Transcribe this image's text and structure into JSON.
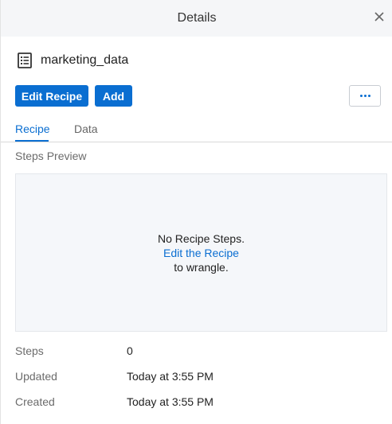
{
  "header": {
    "title": "Details"
  },
  "recipe": {
    "name": "marketing_data"
  },
  "actions": {
    "edit_label": "Edit Recipe",
    "add_label": "Add"
  },
  "tabs": [
    {
      "label": "Recipe"
    },
    {
      "label": "Data"
    }
  ],
  "preview": {
    "section_label": "Steps Preview",
    "empty_line1": "No Recipe Steps.",
    "link_text": "Edit the Recipe",
    "empty_line3": "to wrangle."
  },
  "meta": [
    {
      "label": "Steps",
      "value": "0"
    },
    {
      "label": "Updated",
      "value": "Today at 3:55 PM"
    },
    {
      "label": "Created",
      "value": "Today at 3:55 PM"
    }
  ],
  "icons": {
    "close": "close-icon",
    "recipe": "recipe-document-icon",
    "more": "more-horizontal-icon"
  },
  "colors": {
    "accent": "#0a6ed1",
    "header_bg": "#f5f6f8",
    "preview_bg": "#f5f7fa"
  }
}
